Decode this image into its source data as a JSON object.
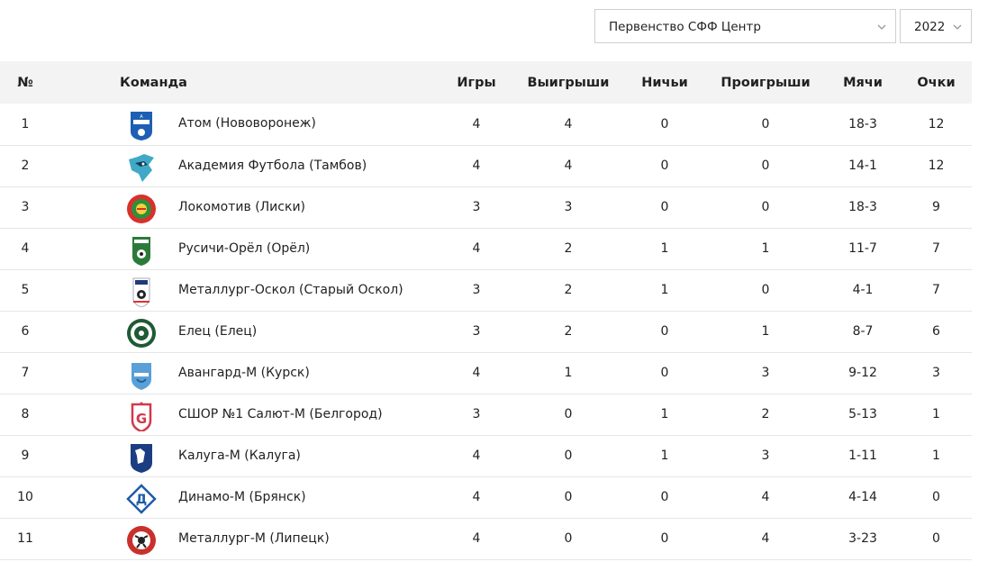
{
  "filters": {
    "league": "Первенство СФФ Центр",
    "year": "2022"
  },
  "table": {
    "headers": {
      "pos": "№",
      "team": "Команда",
      "games": "Игры",
      "wins": "Выигрыши",
      "draws": "Ничьи",
      "losses": "Проигрыши",
      "goals": "Мячи",
      "points": "Очки"
    },
    "rows": [
      {
        "pos": "1",
        "team": "Атом (Нововоронеж)",
        "games": "4",
        "wins": "4",
        "draws": "0",
        "losses": "0",
        "goals": "18-3",
        "points": "12",
        "logo": "atom-logo-icon"
      },
      {
        "pos": "2",
        "team": "Академия Футбола (Тамбов)",
        "games": "4",
        "wins": "4",
        "draws": "0",
        "losses": "0",
        "goals": "14-1",
        "points": "12",
        "logo": "wolf-logo-icon"
      },
      {
        "pos": "3",
        "team": "Локомотив (Лиски)",
        "games": "3",
        "wins": "3",
        "draws": "0",
        "losses": "0",
        "goals": "18-3",
        "points": "9",
        "logo": "lokomotiv-logo-icon"
      },
      {
        "pos": "4",
        "team": "Русичи-Орёл (Орёл)",
        "games": "4",
        "wins": "2",
        "draws": "1",
        "losses": "1",
        "goals": "11-7",
        "points": "7",
        "logo": "rusichi-logo-icon"
      },
      {
        "pos": "5",
        "team": "Металлург-Оскол (Старый Оскол)",
        "games": "3",
        "wins": "2",
        "draws": "1",
        "losses": "0",
        "goals": "4-1",
        "points": "7",
        "logo": "metallurg-oskol-logo-icon"
      },
      {
        "pos": "6",
        "team": "Елец (Елец)",
        "games": "3",
        "wins": "2",
        "draws": "0",
        "losses": "1",
        "goals": "8-7",
        "points": "6",
        "logo": "elets-logo-icon"
      },
      {
        "pos": "7",
        "team": "Авангард-М (Курск)",
        "games": "4",
        "wins": "1",
        "draws": "0",
        "losses": "3",
        "goals": "9-12",
        "points": "3",
        "logo": "avangard-logo-icon"
      },
      {
        "pos": "8",
        "team": "СШОР №1 Салют-М (Белгород)",
        "games": "3",
        "wins": "0",
        "draws": "1",
        "losses": "2",
        "goals": "5-13",
        "points": "1",
        "logo": "salyut-logo-icon"
      },
      {
        "pos": "9",
        "team": "Калуга-М (Калуга)",
        "games": "4",
        "wins": "0",
        "draws": "1",
        "losses": "3",
        "goals": "1-11",
        "points": "1",
        "logo": "kaluga-logo-icon"
      },
      {
        "pos": "10",
        "team": "Динамо-М (Брянск)",
        "games": "4",
        "wins": "0",
        "draws": "0",
        "losses": "4",
        "goals": "4-14",
        "points": "0",
        "logo": "dinamo-logo-icon"
      },
      {
        "pos": "11",
        "team": "Металлург-М (Липецк)",
        "games": "4",
        "wins": "0",
        "draws": "0",
        "losses": "4",
        "goals": "3-23",
        "points": "0",
        "logo": "metallurg-lipetsk-logo-icon"
      }
    ]
  },
  "colors": {
    "header_bg": "#f3f3f3",
    "row_border": "#e6e6e6",
    "select_border": "#cfcfcf"
  }
}
